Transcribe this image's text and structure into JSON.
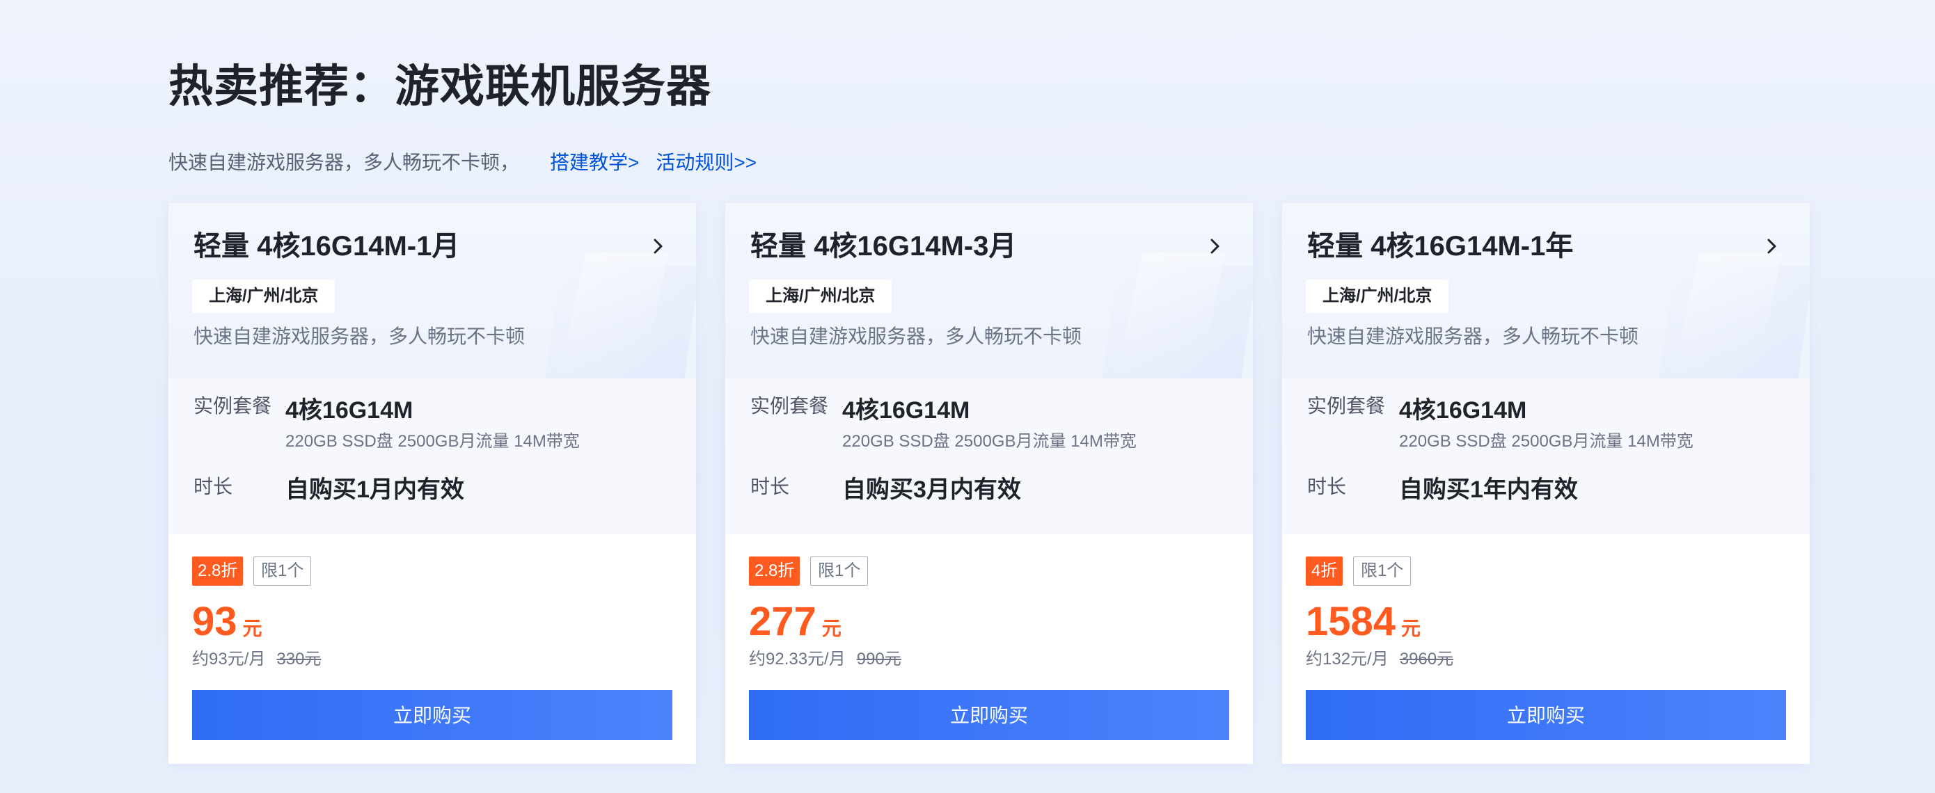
{
  "section": {
    "title": "热卖推荐：游戏联机服务器",
    "subtitle": "快速自建游戏服务器，多人畅玩不卡顿，",
    "link_tutorial": "搭建教学>",
    "link_rules": "活动规则>>"
  },
  "colors": {
    "accent": "#0052d9",
    "price": "#ff5a1f",
    "button": "#3370f7"
  },
  "cards": [
    {
      "title": "轻量 4核16G14M-1月",
      "region": "上海/广州/北京",
      "desc": "快速自建游戏服务器，多人畅玩不卡顿",
      "spec_label": "实例套餐",
      "spec_main": "4核16G14M",
      "spec_sub": "220GB SSD盘 2500GB月流量 14M带宽",
      "duration_label": "时长",
      "duration": "自购买1月内有效",
      "discount": "2.8折",
      "limit": "限1个",
      "price": "93",
      "price_unit": "元",
      "per_month": "约93元/月",
      "original_price": "330元",
      "buy_label": "立即购买"
    },
    {
      "title": "轻量 4核16G14M-3月",
      "region": "上海/广州/北京",
      "desc": "快速自建游戏服务器，多人畅玩不卡顿",
      "spec_label": "实例套餐",
      "spec_main": "4核16G14M",
      "spec_sub": "220GB SSD盘 2500GB月流量 14M带宽",
      "duration_label": "时长",
      "duration": "自购买3月内有效",
      "discount": "2.8折",
      "limit": "限1个",
      "price": "277",
      "price_unit": "元",
      "per_month": "约92.33元/月",
      "original_price": "990元",
      "buy_label": "立即购买"
    },
    {
      "title": "轻量 4核16G14M-1年",
      "region": "上海/广州/北京",
      "desc": "快速自建游戏服务器，多人畅玩不卡顿",
      "spec_label": "实例套餐",
      "spec_main": "4核16G14M",
      "spec_sub": "220GB SSD盘 2500GB月流量 14M带宽",
      "duration_label": "时长",
      "duration": "自购买1年内有效",
      "discount": "4折",
      "limit": "限1个",
      "price": "1584",
      "price_unit": "元",
      "per_month": "约132元/月",
      "original_price": "3960元",
      "buy_label": "立即购买"
    }
  ]
}
